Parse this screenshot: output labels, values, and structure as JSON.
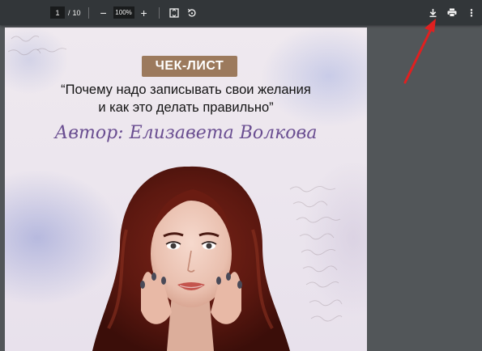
{
  "toolbar": {
    "page_current": "1",
    "page_separator": "/",
    "page_total": "10",
    "zoom_out": "−",
    "zoom_value": "100%",
    "zoom_in": "+",
    "menu": "⋮"
  },
  "document": {
    "badge": "ЧЕК-ЛИСТ",
    "title_line1": "“Почему надо записывать свои желания",
    "title_line2": "и как это делать правильно”",
    "author": "Автор: Елизавета Волкова"
  },
  "colors": {
    "toolbar_bg": "#323639",
    "viewer_bg": "#525659",
    "badge_bg": "#9c7a5d",
    "author_color": "#6a4e91",
    "annotation_arrow": "#e02020"
  },
  "icons": [
    "fit-page-icon",
    "rotate-icon",
    "download-icon",
    "print-icon",
    "more-options-icon"
  ]
}
